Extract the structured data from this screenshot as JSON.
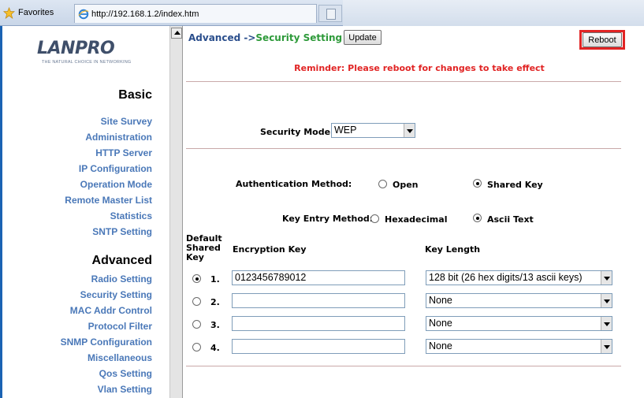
{
  "browser": {
    "favorites_label": "Favorites",
    "tab_url": "http://192.168.1.2/index.htm"
  },
  "logo": {
    "name": "LANPRO",
    "tagline": "THE NATURAL CHOICE IN NETWORKING"
  },
  "sidebar": {
    "basic_title": "Basic",
    "basic_items": [
      "Site Survey",
      "Administration",
      "HTTP Server",
      "IP Configuration",
      "Operation Mode",
      "Remote Master List",
      "Statistics",
      "SNTP Setting"
    ],
    "advanced_title": "Advanced",
    "advanced_items": [
      "Radio Setting",
      "Security Setting",
      "MAC Addr Control",
      "Protocol Filter",
      "SNMP Configuration",
      "Miscellaneous",
      "Qos Setting",
      "Vlan Setting"
    ]
  },
  "header": {
    "breadcrumb_advanced": "Advanced ->",
    "breadcrumb_current": "Security Setting",
    "update_label": "Update",
    "reboot_label": "Reboot",
    "reminder": "Reminder: Please reboot for changes to take effect"
  },
  "security": {
    "mode_label": "Security Mode:",
    "mode_value": "WEP",
    "auth_label": "Authentication Method:",
    "auth_options": [
      "Open",
      "Shared Key"
    ],
    "auth_selected": "Shared Key",
    "key_entry_label": "Key Entry Method:",
    "key_entry_options": [
      "Hexadecimal",
      "Ascii Text"
    ],
    "key_entry_selected": "Ascii Text"
  },
  "keys_table": {
    "col_default": "Default Shared Key",
    "col_default_lines": [
      "Default",
      "Shared",
      "Key"
    ],
    "col_key": "Encryption Key",
    "col_length": "Key Length",
    "rows": [
      {
        "num": "1.",
        "selected": true,
        "key": "0123456789012",
        "length": "128 bit (26 hex digits/13 ascii keys)"
      },
      {
        "num": "2.",
        "selected": false,
        "key": "",
        "length": "None"
      },
      {
        "num": "3.",
        "selected": false,
        "key": "",
        "length": "None"
      },
      {
        "num": "4.",
        "selected": false,
        "key": "",
        "length": "None"
      }
    ]
  }
}
